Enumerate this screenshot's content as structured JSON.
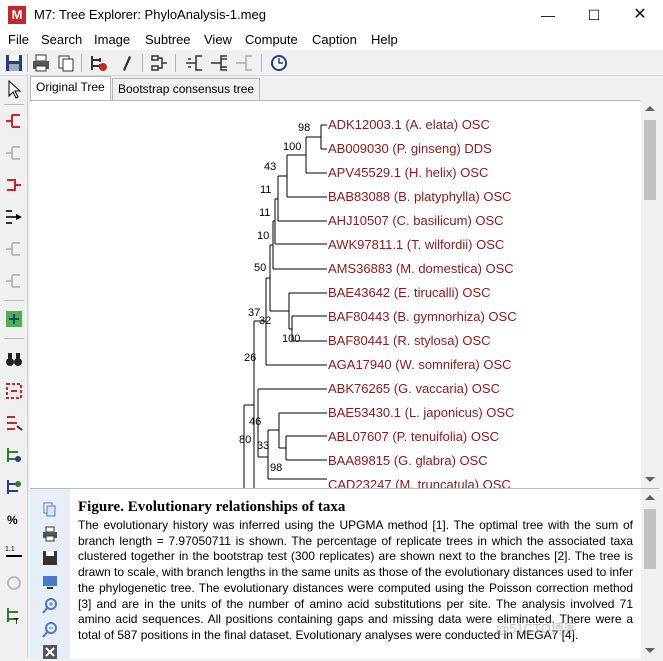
{
  "window": {
    "app_icon_letter": "M",
    "title": "M7: Tree Explorer: PhyloAnalysis-1.meg",
    "minimize_glyph": "—",
    "maximize_glyph": "☐",
    "close_glyph": "✕"
  },
  "menu": [
    "File",
    "Search",
    "Image",
    "Subtree",
    "View",
    "Compute",
    "Caption",
    "Help"
  ],
  "tabs": [
    {
      "label": "Original Tree",
      "active": true
    },
    {
      "label": "Bootstrap consensus tree",
      "active": false
    }
  ],
  "tree": {
    "taxa": [
      "ADK12003.1 (A. elata) OSC",
      "AB009030 (P. ginseng) DDS",
      "APV45529.1 (H. helix) OSC",
      "BAB83088 (B. platyphylla) OSC",
      "AHJ10507 (C. basilicum) OSC",
      "AWK97811.1 (T. wilfordii) OSC",
      "AMS36883 (M. domestica) OSC",
      "BAE43642 (E. tirucalli) OSC",
      "BAF80443 (B. gymnorhiza) OSC",
      "BAF80441 (R. stylosa) OSC",
      "AGA17940 (W. somnifera) OSC",
      "ABK76265 (G. vaccaria) OSC",
      "BAE53430.1 (L. japonicus) OSC",
      "ABL07607 (P. tenuifolia) OSC",
      "BAA89815 (G. glabra) OSC",
      "CAD23247 (M. truncatula) OSC"
    ],
    "support_values": [
      "98",
      "100",
      "43",
      "11",
      "11",
      "10",
      "50",
      "37",
      "32",
      "100",
      "26",
      "46",
      "33",
      "98",
      "80"
    ],
    "taxon_color": "#8b1a1a"
  },
  "caption": {
    "title": "Figure. Evolutionary relationships of taxa",
    "body": "The evolutionary history was inferred using the UPGMA method [1]. The optimal tree with the sum of branch length = 7.97050711 is shown. The percentage of replicate trees in which the associated taxa clustered together in the bootstrap test (300 replicates) are shown next to the branches [2]. The tree is drawn to scale, with branch lengths in the same units as those of the evolutionary distances used to infer the phylogenetic tree. The evolutionary distances were computed using the Poisson correction method [3] and are in the units of the number of amino acid substitutions per site. The analysis involved 71 amino acid sequences. All positions containing gaps and missing data were eliminated. There were a total of 587 positions in the final dataset. Evolutionary analyses were conducted in MEGA7 [4]."
  },
  "watermark": "@51CTO博客"
}
